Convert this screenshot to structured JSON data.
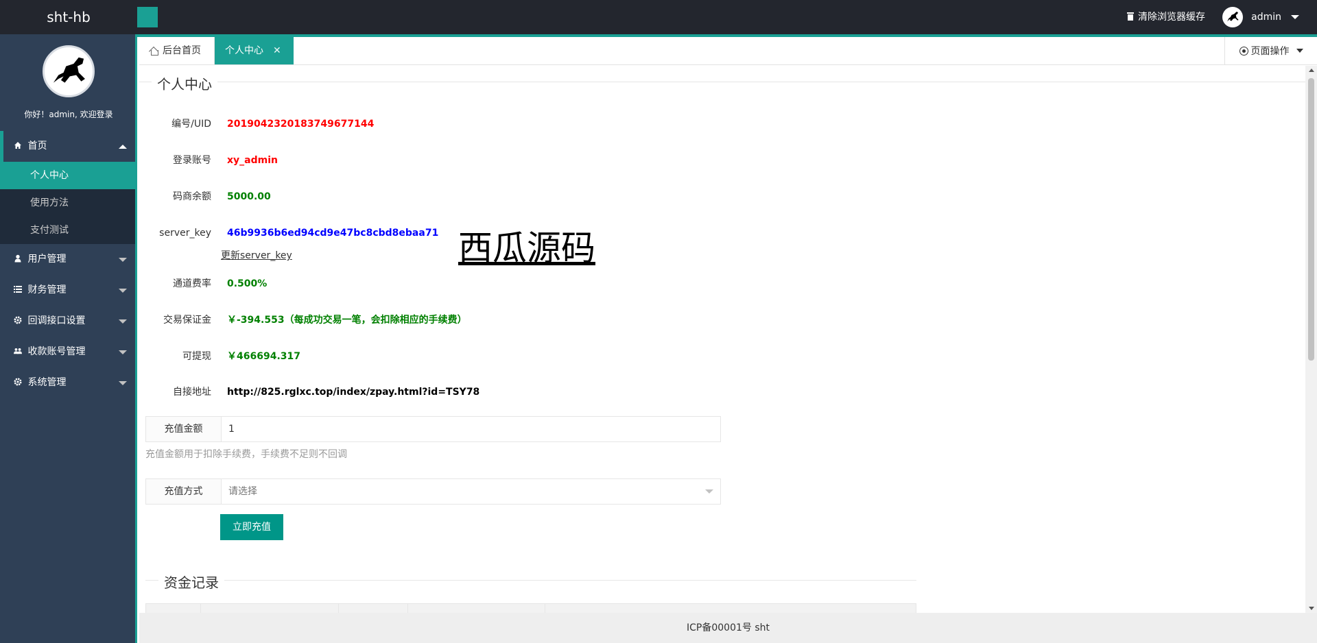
{
  "header": {
    "logo": "sht-hb",
    "clear_cache": "清除浏览器缓存",
    "username": "admin"
  },
  "sidebar": {
    "welcome": "你好！admin, 欢迎登录",
    "menus": [
      {
        "label": "首页",
        "icon": "home-icon"
      },
      {
        "label": "用户管理",
        "icon": "user-icon"
      },
      {
        "label": "财务管理",
        "icon": "list-icon"
      },
      {
        "label": "回调接口设置",
        "icon": "gear-icon"
      },
      {
        "label": "收款账号管理",
        "icon": "users-icon"
      },
      {
        "label": "系统管理",
        "icon": "gear-icon"
      }
    ],
    "submenu": [
      "个人中心",
      "使用方法",
      "支付测试"
    ]
  },
  "tabs": {
    "home": "后台首页",
    "active": "个人中心",
    "page_ops": "页面操作"
  },
  "profile": {
    "section_title": "个人中心",
    "uid_label": "编号/UID",
    "uid_value": "2019042320183749677144",
    "account_label": "登录账号",
    "account_value": "xy_admin",
    "balance_label": "码商余额",
    "balance_value": "5000.00",
    "key_label": "server_key",
    "key_value": "46b9936b6ed94cd9e47bc8cbd8ebaa71",
    "update_key": "更新server_key",
    "watermark": "西瓜源码",
    "rate_label": "通道费率",
    "rate_value": "0.500%",
    "deposit_label": "交易保证金",
    "deposit_value": "￥-394.553（每成功交易一笔，会扣除相应的手续费）",
    "withdraw_label": "可提现",
    "withdraw_value": "￥466694.317",
    "url_label": "自接地址",
    "url_value": "http://825.rglxc.top/index/zpay.html?id=TSY78"
  },
  "recharge": {
    "amount_label": "充值金额",
    "amount_value": "1",
    "hint": "充值金额用于扣除手续费，手续费不足则不回调",
    "method_label": "充值方式",
    "method_placeholder": "请选择",
    "submit": "立即充值"
  },
  "funds": {
    "title": "资金记录"
  },
  "footer": {
    "text": "ICP备00001号 sht"
  },
  "colors": {
    "accent": "#1aa094",
    "sidebar_bg": "#2f4056",
    "header_bg": "#23262e",
    "button": "#009688"
  }
}
